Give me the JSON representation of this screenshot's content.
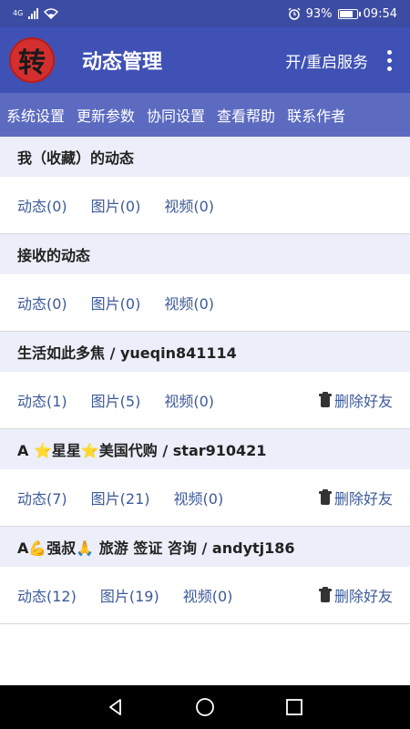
{
  "status": {
    "network": "4G",
    "battery_text": "93%",
    "battery_level": 0.93,
    "time": "09:54"
  },
  "appbar": {
    "logo_char": "转",
    "title": "动态管理",
    "action_label": "开/重启服务"
  },
  "menu": [
    {
      "label": "系统设置"
    },
    {
      "label": "更新参数"
    },
    {
      "label": "协同设置"
    },
    {
      "label": "查看帮助"
    },
    {
      "label": "联系作者"
    }
  ],
  "sections": [
    {
      "title": "我（收藏）的动态",
      "moments": "动态(0)",
      "photos": "图片(0)",
      "videos": "视频(0)",
      "delete": ""
    },
    {
      "title": "接收的动态",
      "moments": "动态(0)",
      "photos": "图片(0)",
      "videos": "视频(0)",
      "delete": ""
    },
    {
      "title": "生活如此多焦 / yueqin841114",
      "moments": "动态(1)",
      "photos": "图片(5)",
      "videos": "视频(0)",
      "delete": "删除好友"
    },
    {
      "title": "A ⭐星星⭐美国代购 / star910421",
      "moments": "动态(7)",
      "photos": "图片(21)",
      "videos": "视频(0)",
      "delete": "删除好友"
    },
    {
      "title": "A💪强叔🙏 旅游 签证 咨询 / andytj186",
      "moments": "动态(12)",
      "photos": "图片(19)",
      "videos": "视频(0)",
      "delete": "删除好友"
    }
  ],
  "icons": {
    "signal": "signal-icon",
    "wifi": "wifi-icon",
    "alarm": "alarm-icon",
    "battery": "battery-icon",
    "overflow": "more-vert-icon",
    "trash": "trash-icon",
    "back": "back-icon",
    "home": "home-icon",
    "recents": "recents-icon"
  }
}
